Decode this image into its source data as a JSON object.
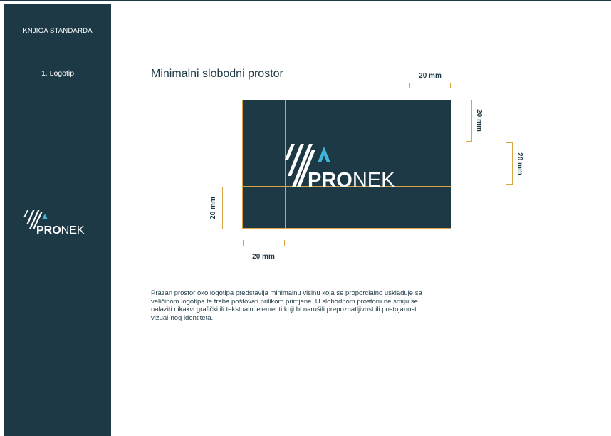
{
  "sidebar": {
    "title": "KNJIGA STANDARDA",
    "items": [
      {
        "label": "1. Logotip"
      }
    ],
    "logo": {
      "text_bold": "PRO",
      "text_light": "NEK"
    }
  },
  "main": {
    "heading": "Minimalni slobodni prostor",
    "diagram": {
      "logo": {
        "text_bold": "PRO",
        "text_light": "NEK"
      },
      "dimensions": {
        "top": "20 mm",
        "right_upper": "20 mm",
        "right_outer": "20 mm",
        "left": "20 mm",
        "bottom": "20 mm"
      }
    },
    "description": "Prazan prostor oko logotipa predstavlja minimalnu visinu koja se proporcialno usklađuje sa veličinom logotipa te treba poštovati prilikom primjene. U slobodnom prostoru ne smiju se nalaziti nikakvi grafički ili tekstualni elementi koji bi narušili prepoznatljivost ili postojanost vizual-nog identiteta."
  },
  "colors": {
    "navy": "#1d3945",
    "accent_blue": "#3fb5d8",
    "guide_gold": "#d9a441",
    "white": "#ffffff"
  }
}
